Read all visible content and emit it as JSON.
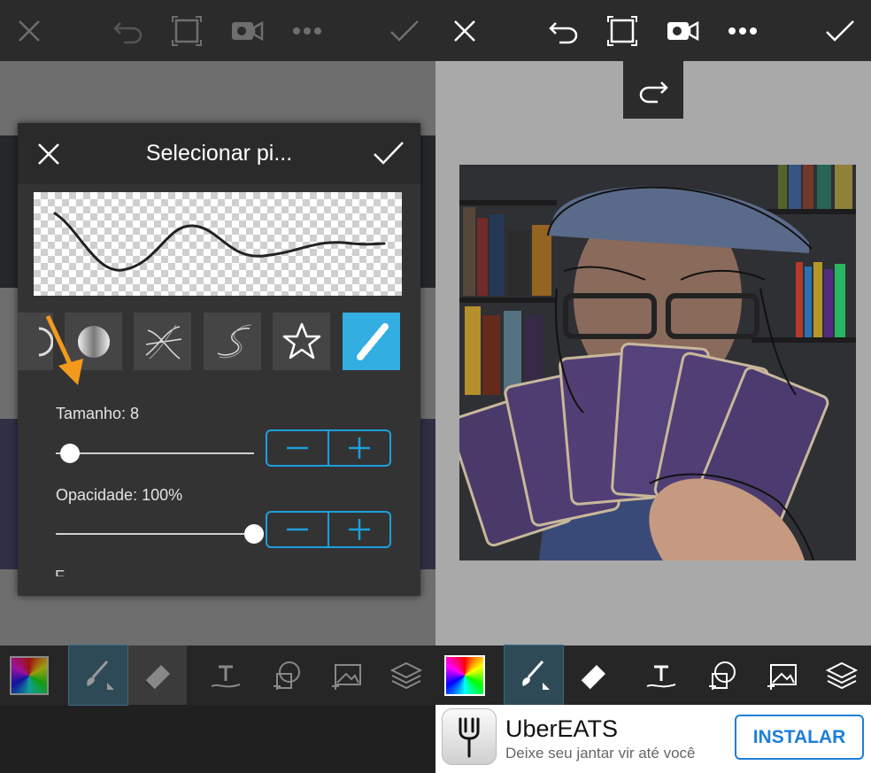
{
  "left": {
    "dialog": {
      "title": "Selecionar pi...",
      "size_label": "Tamanho: 8",
      "size_value": 8,
      "opacity_label": "Opacidade: 100%",
      "opacity_value": 100,
      "cut_label": "F"
    },
    "brushes": [
      "partial-brush",
      "gradient-brush",
      "cross-stroke-brush",
      "wave-brush",
      "star-brush",
      "sparkle-brush"
    ]
  },
  "right": {
    "ad": {
      "title": "UberEATS",
      "subtitle": "Deixe seu jantar vir até você",
      "button": "INSTALAR"
    }
  },
  "colors": {
    "accent": "#1d9fdc",
    "selected_brush": "#33aee3",
    "arrow": "#f39a1e"
  }
}
